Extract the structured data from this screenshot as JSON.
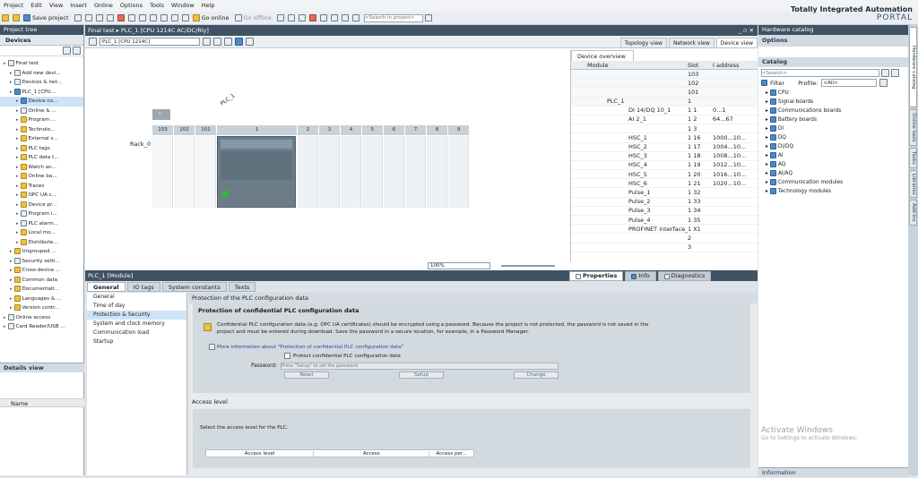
{
  "menubar": {
    "items": [
      "Project",
      "Edit",
      "View",
      "Insert",
      "Online",
      "Options",
      "Tools",
      "Window",
      "Help"
    ]
  },
  "toolbar": {
    "save_project": "Save project",
    "go_online": "Go online",
    "go_offline": "Go offline",
    "search_placeholder": "<Search in project>"
  },
  "branding": {
    "line1": "Totally Integrated Automation",
    "line2": "PORTAL"
  },
  "project_tree": {
    "title": "Project tree",
    "tab": "Devices",
    "items": [
      {
        "label": "Final test",
        "indent": 0,
        "icon": "project-icon"
      },
      {
        "label": "Add new devi...",
        "indent": 1,
        "icon": "add-device-icon"
      },
      {
        "label": "Devices & net...",
        "indent": 1,
        "icon": "network-icon"
      },
      {
        "label": "PLC_1 [CPU...",
        "indent": 1,
        "icon": "plc-icon"
      },
      {
        "label": "Device co...",
        "indent": 2,
        "icon": "device-config-icon"
      },
      {
        "label": "Online & ...",
        "indent": 2,
        "icon": "online-diag-icon"
      },
      {
        "label": "Program ...",
        "indent": 2,
        "icon": "folder-icon"
      },
      {
        "label": "Technolo...",
        "indent": 2,
        "icon": "folder-icon"
      },
      {
        "label": "External s...",
        "indent": 2,
        "icon": "folder-icon"
      },
      {
        "label": "PLC tags",
        "indent": 2,
        "icon": "folder-icon"
      },
      {
        "label": "PLC data t...",
        "indent": 2,
        "icon": "folder-icon"
      },
      {
        "label": "Watch an...",
        "indent": 2,
        "icon": "folder-icon"
      },
      {
        "label": "Online ba...",
        "indent": 2,
        "icon": "folder-icon"
      },
      {
        "label": "Traces",
        "indent": 2,
        "icon": "folder-icon"
      },
      {
        "label": "OPC UA c...",
        "indent": 2,
        "icon": "folder-icon"
      },
      {
        "label": "Device pr...",
        "indent": 2,
        "icon": "folder-icon"
      },
      {
        "label": "Program i...",
        "indent": 2,
        "icon": "doc-icon"
      },
      {
        "label": "PLC alarm...",
        "indent": 2,
        "icon": "doc-icon"
      },
      {
        "label": "Local mo...",
        "indent": 2,
        "icon": "folder-icon"
      },
      {
        "label": "Distribute...",
        "indent": 2,
        "icon": "folder-icon"
      },
      {
        "label": "Ungrouped ...",
        "indent": 1,
        "icon": "folder-icon"
      },
      {
        "label": "Security setti...",
        "indent": 1,
        "icon": "security-icon"
      },
      {
        "label": "Cross-device ...",
        "indent": 1,
        "icon": "folder-icon"
      },
      {
        "label": "Common data",
        "indent": 1,
        "icon": "folder-icon"
      },
      {
        "label": "Documentati...",
        "indent": 1,
        "icon": "folder-icon"
      },
      {
        "label": "Languages & ...",
        "indent": 1,
        "icon": "folder-icon"
      },
      {
        "label": "Version contr...",
        "indent": 1,
        "icon": "folder-icon"
      },
      {
        "label": "Online access",
        "indent": 0,
        "icon": "online-icon"
      },
      {
        "label": "Card Reader/USB ...",
        "indent": 0,
        "icon": "card-reader-icon"
      }
    ],
    "details_view": "Details view",
    "details_col": "Name"
  },
  "editor": {
    "breadcrumb": "Final test  ▸  PLC_1 [CPU 1214C AC/DC/Rly]",
    "device_select": "PLC_1 [CPU 1214C]",
    "device_label": "PLC_1",
    "rack_label": "Rack_0",
    "slots": [
      "103",
      "102",
      "101",
      "1",
      "2",
      "3",
      "4",
      "5",
      "6",
      "7",
      "8",
      "9"
    ],
    "zoom": "100%",
    "view_tabs": [
      "Topology view",
      "Network view",
      "Device view"
    ]
  },
  "device_overview": {
    "tab": "Device overview",
    "columns": [
      "Module",
      "Slot",
      "I address"
    ],
    "rows": [
      {
        "module": "",
        "sub": "",
        "slot": "103",
        "addr": ""
      },
      {
        "module": "",
        "sub": "",
        "slot": "102",
        "addr": ""
      },
      {
        "module": "",
        "sub": "",
        "slot": "101",
        "addr": ""
      },
      {
        "module": "PLC_1",
        "sub": "",
        "slot": "1",
        "addr": ""
      },
      {
        "module": "",
        "sub": "DI 14/DQ 10_1",
        "slot": "1 1",
        "addr": "0...1"
      },
      {
        "module": "",
        "sub": "AI 2_1",
        "slot": "1 2",
        "addr": "64...67"
      },
      {
        "module": "",
        "sub": "",
        "slot": "1 3",
        "addr": ""
      },
      {
        "module": "",
        "sub": "HSC_1",
        "slot": "1 16",
        "addr": "1000...10..."
      },
      {
        "module": "",
        "sub": "HSC_2",
        "slot": "1 17",
        "addr": "1004...10..."
      },
      {
        "module": "",
        "sub": "HSC_3",
        "slot": "1 18",
        "addr": "1008...10..."
      },
      {
        "module": "",
        "sub": "HSC_4",
        "slot": "1 19",
        "addr": "1012...10..."
      },
      {
        "module": "",
        "sub": "HSC_5",
        "slot": "1 20",
        "addr": "1016...10..."
      },
      {
        "module": "",
        "sub": "HSC_6",
        "slot": "1 21",
        "addr": "1020...10..."
      },
      {
        "module": "",
        "sub": "Pulse_1",
        "slot": "1 32",
        "addr": ""
      },
      {
        "module": "",
        "sub": "Pulse_2",
        "slot": "1 33",
        "addr": ""
      },
      {
        "module": "",
        "sub": "Pulse_3",
        "slot": "1 34",
        "addr": ""
      },
      {
        "module": "",
        "sub": "Pulse_4",
        "slot": "1 35",
        "addr": ""
      },
      {
        "module": "",
        "sub": "PROFINET interface_1",
        "slot": "1 X1",
        "addr": ""
      },
      {
        "module": "",
        "sub": "",
        "slot": "2",
        "addr": ""
      },
      {
        "module": "",
        "sub": "",
        "slot": "3",
        "addr": ""
      }
    ]
  },
  "inspector": {
    "title": "PLC_1 [Module]",
    "tabs": [
      "General",
      "IO tags",
      "System constants",
      "Texts"
    ],
    "right_tabs": [
      "Properties",
      "Info",
      "Diagnostics"
    ],
    "nav": [
      "General",
      "Time of day",
      "Protection & Security",
      "System and clock memory",
      "Communication load",
      "Startup"
    ],
    "section_title": "Protection of the PLC configuration data",
    "sub_title": "Protection of confidential PLC configuration data",
    "warning": "Confidential PLC configuration data (e.g. OPC UA certificates) should be encrypted using a password. Because the project is not protected, the password is not saved in the project and must be entered during download. Save the password in a secure location, for example, in a Password Manager.",
    "more_info": "More information about \"Protection of confidential PLC configuration data\"",
    "checkbox_label": "Protect confidential PLC configuration data",
    "password_label": "Password:",
    "password_placeholder": "Press \"Setup\" to set the password",
    "reset": "Reset",
    "setup": "Setup",
    "change": "Change",
    "access_title": "Access level",
    "access_desc": "Select the access level for the PLC.",
    "access_cols": [
      "Access level",
      "Access",
      "Access per..."
    ]
  },
  "catalog": {
    "title": "Hardware catalog",
    "options": "Options",
    "catalog_label": "Catalog",
    "search_placeholder": "<Search>",
    "filter": "Filter",
    "profile_label": "Profile:",
    "profile_value": "<All>",
    "items": [
      "CPU",
      "Signal boards",
      "Communications boards",
      "Battery boards",
      "DI",
      "DQ",
      "DI/DQ",
      "AI",
      "AQ",
      "AI/AQ",
      "Communication modules",
      "Technology modules"
    ],
    "info": "Information"
  },
  "right_tabs": [
    "Hardware catalog",
    "Online tools",
    "Tasks",
    "Libraries",
    "Add-ins"
  ],
  "watermark": {
    "line1": "Activate Windows",
    "line2": "Go to Settings to activate Windows."
  }
}
